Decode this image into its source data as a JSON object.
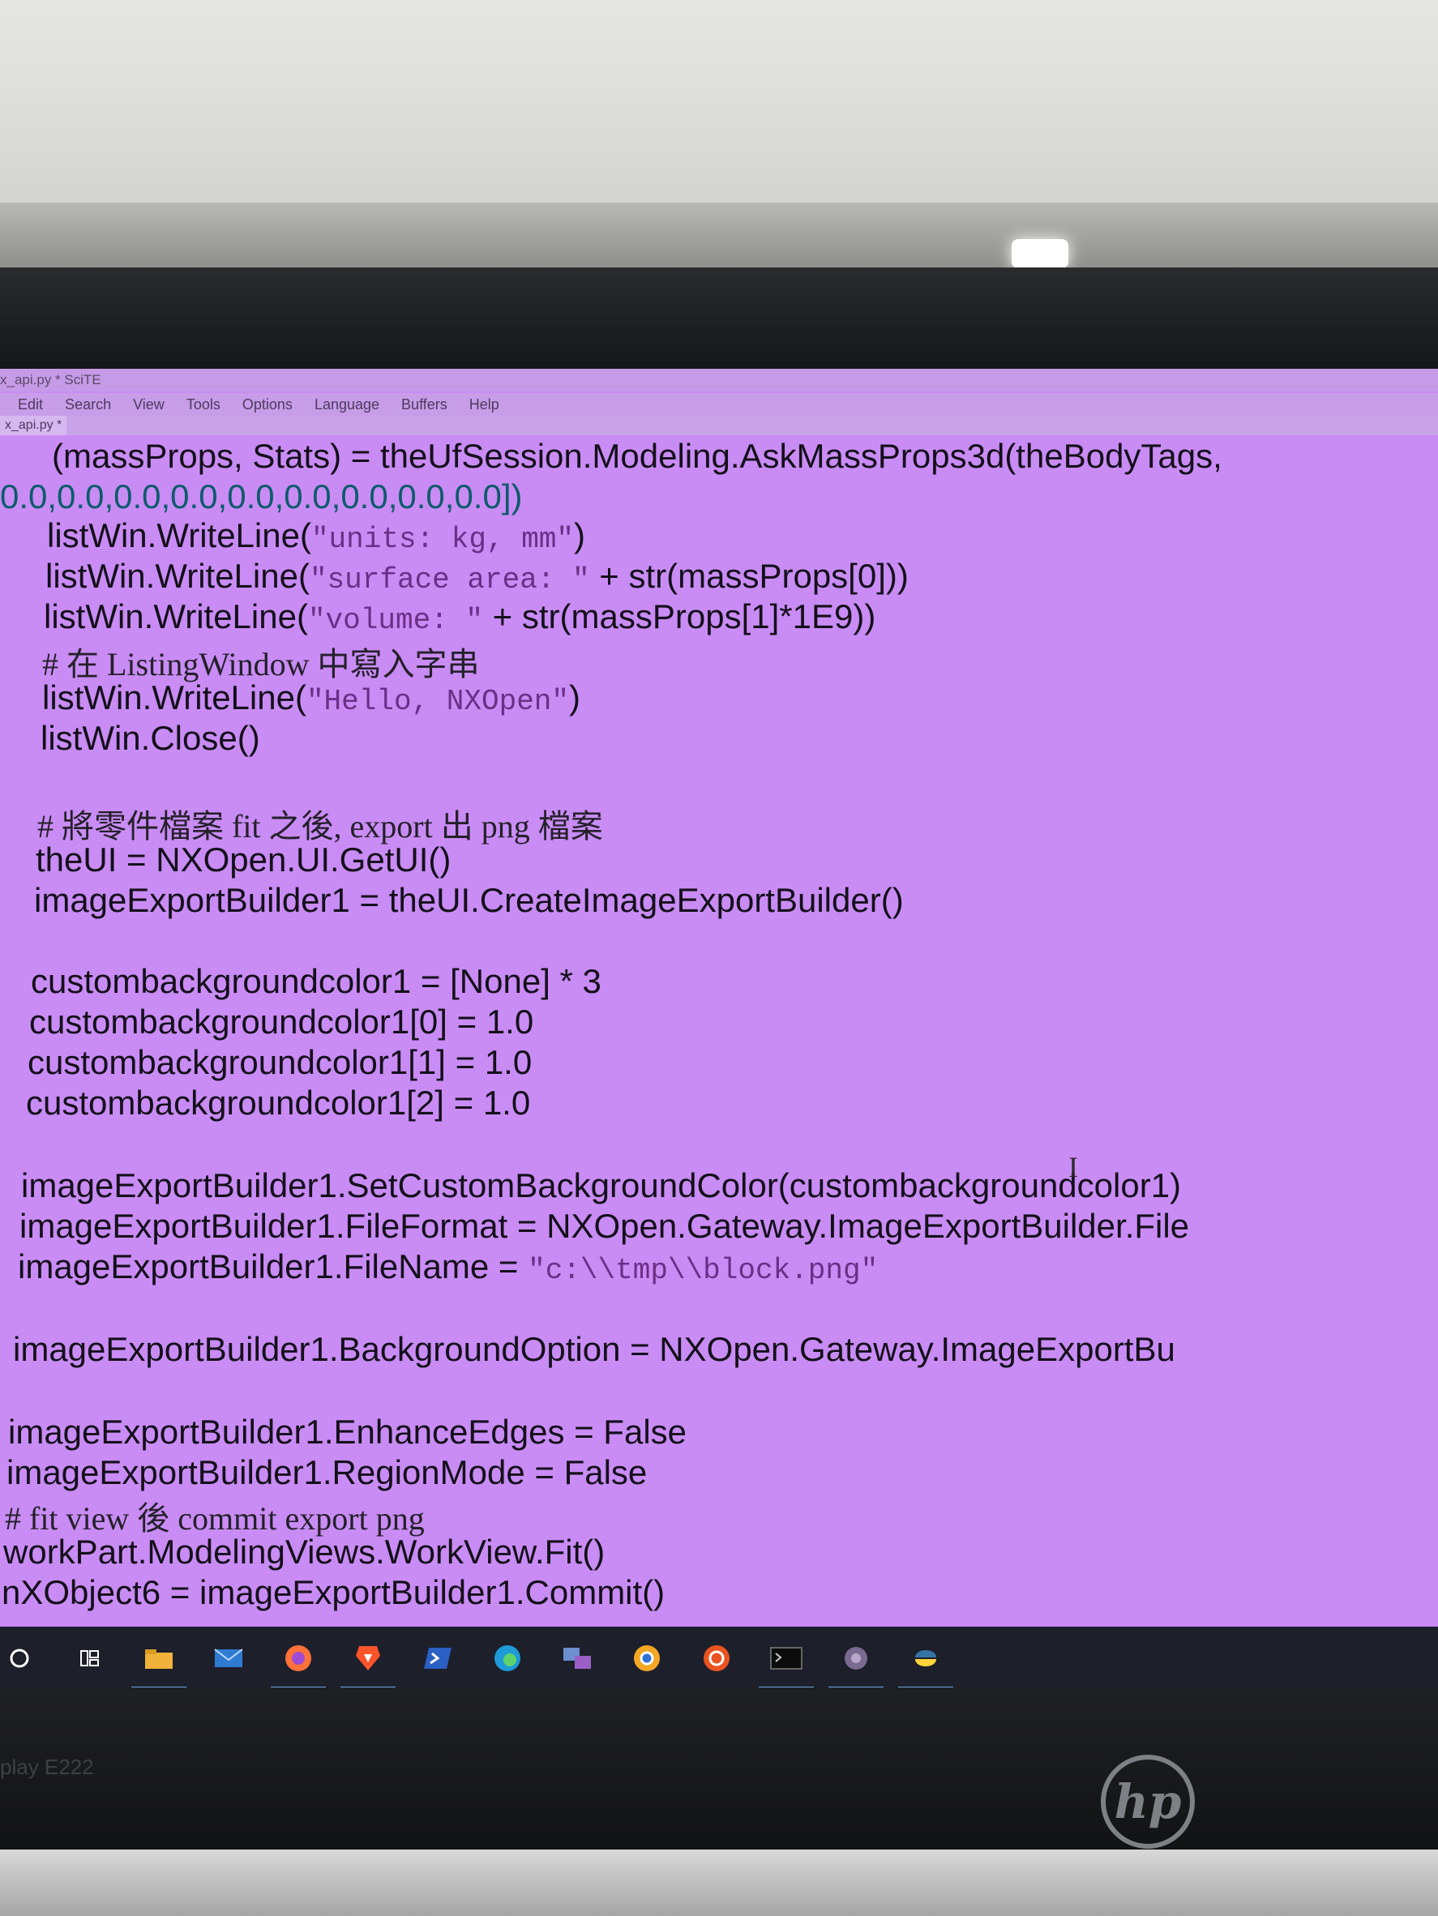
{
  "window": {
    "title": "x_api.py * SciTE"
  },
  "menu": [
    "Edit",
    "Search",
    "View",
    "Tools",
    "Options",
    "Language",
    "Buffers",
    "Help"
  ],
  "tab": {
    "label": "x_api.py *"
  },
  "code": {
    "l1": "(massProps, Stats) = theUfSession.Modeling.AskMassProps3d(theBodyTags,",
    "l2": "0.0,0.0,0.0,0.0,0.0,0.0,0.0,0.0,0.0])",
    "l3a": "listWin.WriteLine(",
    "l3s": "\"units: kg, mm\"",
    "l3b": ")",
    "l4a": "listWin.WriteLine(",
    "l4s": "\"surface area: \"",
    "l4b": " + str(massProps[0]))",
    "l5a": "listWin.WriteLine(",
    "l5s": "\"volume: \"",
    "l5b": " + str(massProps[1]*1E9))",
    "l6": "# 在 ListingWindow 中寫入字串",
    "l7a": "listWin.WriteLine(",
    "l7s": "\"Hello, NXOpen\"",
    "l7b": ")",
    "l8": "listWin.Close()",
    "l9": "# 將零件檔案 fit 之後, export 出 png 檔案",
    "l10": "theUI = NXOpen.UI.GetUI()",
    "l11": "imageExportBuilder1 = theUI.CreateImageExportBuilder()",
    "l12": "custombackgroundcolor1 = [None] * 3",
    "l13": "custombackgroundcolor1[0] = 1.0",
    "l14": "custombackgroundcolor1[1] = 1.0",
    "l15": "custombackgroundcolor1[2] = 1.0",
    "l16": "imageExportBuilder1.SetCustomBackgroundColor(custombackgroundcolor1)",
    "l17": "imageExportBuilder1.FileFormat = NXOpen.Gateway.ImageExportBuilder.File",
    "l18a": "imageExportBuilder1.FileName = ",
    "l18s": "\"c:\\\\tmp\\\\block.png\"",
    "l19": "imageExportBuilder1.BackgroundOption = NXOpen.Gateway.ImageExportBu",
    "l20": "imageExportBuilder1.EnhanceEdges = False",
    "l21": "imageExportBuilder1.RegionMode = False",
    "l22": "# fit view 後 commit export png",
    "l23": "workPart.ModelingViews.WorkView.Fit()",
    "l24": "nXObject6 = imageExportBuilder1.Commit()"
  },
  "taskbar": {
    "icons": [
      "search-icon",
      "task-view-icon",
      "file-explorer-icon",
      "mail-icon",
      "firefox-icon",
      "brave-icon",
      "powershell-icon",
      "edge-icon",
      "network-icon",
      "chrome-icon",
      "ubuntu-icon",
      "terminal-icon",
      "scite-icon",
      "python-icon"
    ]
  },
  "monitor": {
    "model_label": "play E222",
    "brand": "hp"
  },
  "colors": {
    "screen_bg": "#c98cf5",
    "taskbar_bg": "#1d1f2b"
  }
}
